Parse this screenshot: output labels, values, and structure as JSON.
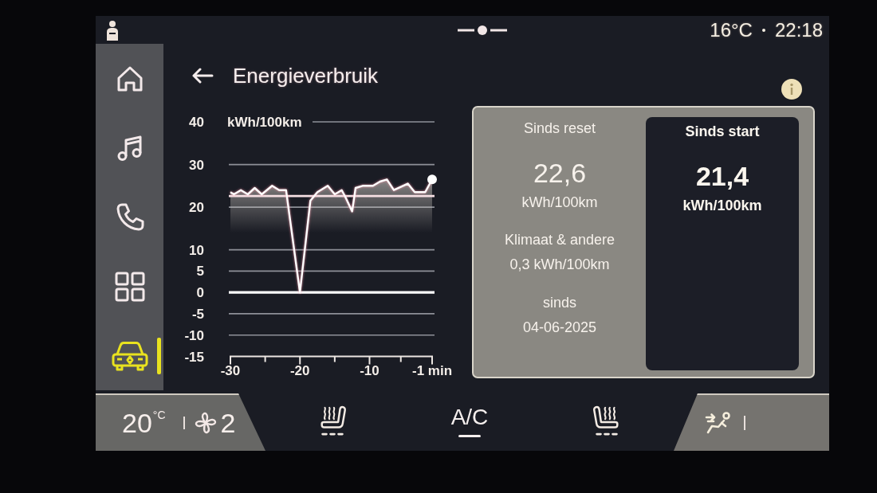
{
  "status_bar": {
    "outside_temperature": "16°C",
    "time": "22:18"
  },
  "sidebar": {
    "items": [
      {
        "kind": "home",
        "selected": false
      },
      {
        "kind": "music",
        "selected": false
      },
      {
        "kind": "phone",
        "selected": false
      },
      {
        "kind": "apps",
        "selected": false
      },
      {
        "kind": "vehicle",
        "selected": true
      }
    ]
  },
  "header": {
    "title": "Energieverbruik"
  },
  "chart": {
    "chart_data": {
      "type": "area",
      "ylabel": "kWh/100km",
      "x": [
        -30,
        -29.5,
        -28.5,
        -27.5,
        -26.5,
        -25.5,
        -24,
        -23,
        -22,
        -20,
        -18.5,
        -17.5,
        -16,
        -15,
        -14,
        -13.5,
        -12.5,
        -12,
        -11,
        -9.5,
        -8.5,
        -7.5,
        -6.5,
        -4.5,
        -3.5,
        -2,
        -1
      ],
      "values": [
        23.5,
        23,
        24,
        23,
        24.5,
        23,
        25,
        24,
        24,
        0,
        21.5,
        23.5,
        25,
        23,
        24,
        22.5,
        19,
        24.5,
        25,
        25,
        26,
        26.5,
        24,
        25.5,
        23.5,
        23.5,
        26.5
      ],
      "xlim": [
        -30,
        -1
      ],
      "ylim": [
        -15,
        40
      ],
      "xticks": [
        -30,
        -20,
        -10,
        {
          "value": -1,
          "label": "-1 min"
        }
      ],
      "yticks": [
        -15,
        -10,
        -5,
        0,
        5,
        10,
        20,
        30,
        40
      ],
      "grid": true,
      "ref_lines": [
        {
          "axis": "y",
          "value": 22.6
        }
      ]
    }
  },
  "summary": {
    "periods": [
      {
        "label": "Sinds reset",
        "value": "22,6",
        "unit": "kWh/100km",
        "selected": false,
        "details": [
          {
            "label": "Klimaat & andere",
            "value": "0,3 kWh/100km"
          },
          {
            "label": "sinds",
            "value": "04-06-2025"
          }
        ]
      },
      {
        "label": "Sinds start",
        "value": "21,4",
        "unit": "kWh/100km",
        "selected": true
      }
    ]
  },
  "climate_bar": {
    "temperature": "20",
    "temperature_unit": "°C",
    "fan_level": "2",
    "controls": [
      {
        "kind": "left_seat_heater"
      },
      {
        "kind": "ac",
        "label": "A/C"
      },
      {
        "kind": "right_seat_heater"
      }
    ]
  }
}
